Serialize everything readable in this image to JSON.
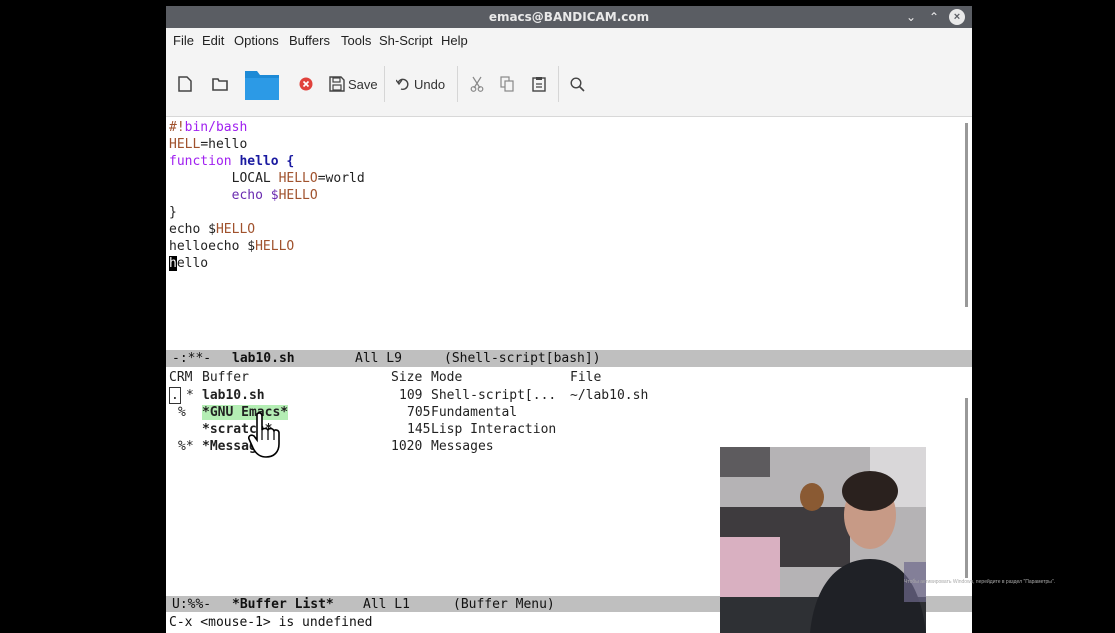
{
  "window": {
    "title": "emacs@BANDICAM.com"
  },
  "menubar": {
    "items": [
      "File",
      "Edit",
      "Options",
      "Buffers",
      "Tools",
      "Sh-Script",
      "Help"
    ]
  },
  "toolbar": {
    "save_label": "Save",
    "undo_label": "Undo",
    "icons": [
      "new-file-icon",
      "open-file-icon",
      "dired-folder-icon",
      "close-buffer-icon",
      "save-icon",
      "undo-icon",
      "cut-icon",
      "copy-icon",
      "paste-icon",
      "search-icon"
    ]
  },
  "editor": {
    "lines": [
      [
        "#!",
        "bin/bash"
      ],
      [
        "HELL",
        "=hello"
      ],
      [
        "function",
        " hello {"
      ],
      [
        "        LOCAL ",
        "HELLO",
        "=world"
      ],
      [
        "        echo $",
        "HELLO"
      ],
      [
        "}"
      ],
      [
        "echo $",
        "HELLO"
      ],
      [
        "helloecho $",
        "HELLO"
      ],
      [
        "h",
        "ello"
      ]
    ]
  },
  "modeline_top": {
    "status": "-:**-",
    "buffer": "lab10.sh",
    "position": "All L9",
    "mode": "(Shell-script[bash])"
  },
  "buffer_list": {
    "headers": {
      "crm": "CRM",
      "buffer": "Buffer",
      "size": "Size",
      "mode": "Mode",
      "file": "File"
    },
    "rows": [
      {
        "crm_a": ".",
        "crm_b": "*",
        "name": "lab10.sh",
        "size": "109",
        "mode": "Shell-script[...",
        "file": "~/lab10.sh"
      },
      {
        "crm_a": "",
        "crm_b": "%",
        "name": "*GNU Emacs*",
        "size": "705",
        "mode": "Fundamental",
        "file": ""
      },
      {
        "crm_a": "",
        "crm_b": "",
        "name": "*scratch*",
        "size": "145",
        "mode": "Lisp Interaction",
        "file": ""
      },
      {
        "crm_a": "%*",
        "crm_b": "",
        "name": "*Messages*",
        "size": "1020",
        "mode": "Messages",
        "file": ""
      }
    ]
  },
  "modeline_bottom": {
    "status": "U:%%-",
    "buffer": "*Buffer List*",
    "position": "All L1",
    "mode": "(Buffer Menu)"
  },
  "minibuffer": {
    "message": "C-x <mouse-1> is undefined"
  },
  "watermark": {
    "text": "Чтобы активировать Windows, перейдите в раздел \"Параметры\"."
  },
  "colors": {
    "keyword": "#a020f0",
    "variable": "#a0522d",
    "highlight": "#b4eeb4",
    "modeline": "#bfbfbf"
  }
}
